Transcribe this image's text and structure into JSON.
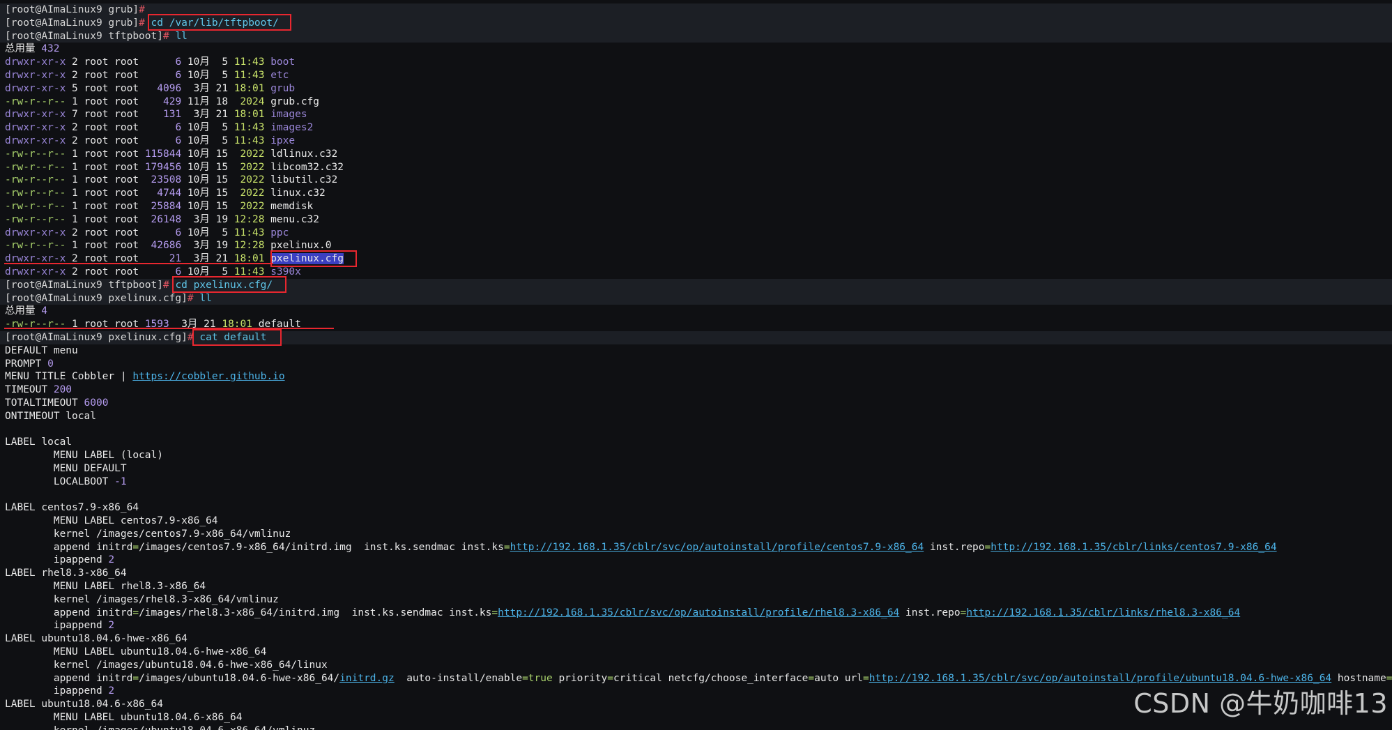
{
  "terminal": {
    "lines": [
      {
        "prompt_bg": true,
        "segs": [
          [
            "p",
            "[root@AImaLinux9 grub]"
          ],
          [
            "h",
            "#"
          ]
        ]
      },
      {
        "prompt_bg": true,
        "segs": [
          [
            "p",
            "[root@AImaLinux9 grub]"
          ],
          [
            "h",
            "# "
          ],
          [
            "c",
            "cd /var/lib/tftpboot/"
          ]
        ]
      },
      {
        "prompt_bg": true,
        "segs": [
          [
            "p",
            "[root@AImaLinux9 tftpboot]"
          ],
          [
            "h",
            "# "
          ],
          [
            "c",
            "ll"
          ]
        ]
      },
      {
        "segs": [
          [
            "w",
            "总用量 "
          ],
          [
            "n",
            "432"
          ]
        ]
      },
      {
        "segs": [
          [
            "pd",
            "drwxr-xr-x"
          ],
          [
            "w",
            " 2 root root      "
          ],
          [
            "n",
            "6"
          ],
          [
            "w",
            " 10月  5 "
          ],
          [
            "t",
            "11:43"
          ],
          [
            "w",
            " "
          ],
          [
            "d",
            "boot"
          ]
        ]
      },
      {
        "segs": [
          [
            "pd",
            "drwxr-xr-x"
          ],
          [
            "w",
            " 2 root root      "
          ],
          [
            "n",
            "6"
          ],
          [
            "w",
            " 10月  5 "
          ],
          [
            "t",
            "11:43"
          ],
          [
            "w",
            " "
          ],
          [
            "d",
            "etc"
          ]
        ]
      },
      {
        "segs": [
          [
            "pd",
            "drwxr-xr-x"
          ],
          [
            "w",
            " 5 root root   "
          ],
          [
            "n",
            "4096"
          ],
          [
            "w",
            "  3月 21 "
          ],
          [
            "t",
            "18:01"
          ],
          [
            "w",
            " "
          ],
          [
            "d",
            "grub"
          ]
        ]
      },
      {
        "segs": [
          [
            "pf",
            "-rw-r--r--"
          ],
          [
            "w",
            " 1 root root    "
          ],
          [
            "n",
            "429"
          ],
          [
            "w",
            " 11月 18  "
          ],
          [
            "y",
            "2024"
          ],
          [
            "w",
            " grub.cfg"
          ]
        ]
      },
      {
        "segs": [
          [
            "pd",
            "drwxr-xr-x"
          ],
          [
            "w",
            " 7 root root    "
          ],
          [
            "n",
            "131"
          ],
          [
            "w",
            "  3月 21 "
          ],
          [
            "t",
            "18:01"
          ],
          [
            "w",
            " "
          ],
          [
            "d",
            "images"
          ]
        ]
      },
      {
        "segs": [
          [
            "pd",
            "drwxr-xr-x"
          ],
          [
            "w",
            " 2 root root      "
          ],
          [
            "n",
            "6"
          ],
          [
            "w",
            " 10月  5 "
          ],
          [
            "t",
            "11:43"
          ],
          [
            "w",
            " "
          ],
          [
            "d",
            "images2"
          ]
        ]
      },
      {
        "segs": [
          [
            "pd",
            "drwxr-xr-x"
          ],
          [
            "w",
            " 2 root root      "
          ],
          [
            "n",
            "6"
          ],
          [
            "w",
            " 10月  5 "
          ],
          [
            "t",
            "11:43"
          ],
          [
            "w",
            " "
          ],
          [
            "d",
            "ipxe"
          ]
        ]
      },
      {
        "segs": [
          [
            "pf",
            "-rw-r--r--"
          ],
          [
            "w",
            " 1 root root "
          ],
          [
            "n",
            "115844"
          ],
          [
            "w",
            " 10月 15  "
          ],
          [
            "y",
            "2022"
          ],
          [
            "w",
            " ldlinux.c32"
          ]
        ]
      },
      {
        "segs": [
          [
            "pf",
            "-rw-r--r--"
          ],
          [
            "w",
            " 1 root root "
          ],
          [
            "n",
            "179456"
          ],
          [
            "w",
            " 10月 15  "
          ],
          [
            "y",
            "2022"
          ],
          [
            "w",
            " libcom32.c32"
          ]
        ]
      },
      {
        "segs": [
          [
            "pf",
            "-rw-r--r--"
          ],
          [
            "w",
            " 1 root root  "
          ],
          [
            "n",
            "23508"
          ],
          [
            "w",
            " 10月 15  "
          ],
          [
            "y",
            "2022"
          ],
          [
            "w",
            " libutil.c32"
          ]
        ]
      },
      {
        "segs": [
          [
            "pf",
            "-rw-r--r--"
          ],
          [
            "w",
            " 1 root root   "
          ],
          [
            "n",
            "4744"
          ],
          [
            "w",
            " 10月 15  "
          ],
          [
            "y",
            "2022"
          ],
          [
            "w",
            " linux.c32"
          ]
        ]
      },
      {
        "segs": [
          [
            "pf",
            "-rw-r--r--"
          ],
          [
            "w",
            " 1 root root  "
          ],
          [
            "n",
            "25884"
          ],
          [
            "w",
            " 10月 15  "
          ],
          [
            "y",
            "2022"
          ],
          [
            "w",
            " memdisk"
          ]
        ]
      },
      {
        "segs": [
          [
            "pf",
            "-rw-r--r--"
          ],
          [
            "w",
            " 1 root root  "
          ],
          [
            "n",
            "26148"
          ],
          [
            "w",
            "  3月 19 "
          ],
          [
            "t",
            "12:28"
          ],
          [
            "w",
            " menu.c32"
          ]
        ]
      },
      {
        "segs": [
          [
            "pd",
            "drwxr-xr-x"
          ],
          [
            "w",
            " 2 root root      "
          ],
          [
            "n",
            "6"
          ],
          [
            "w",
            " 10月  5 "
          ],
          [
            "t",
            "11:43"
          ],
          [
            "w",
            " "
          ],
          [
            "d",
            "ppc"
          ]
        ]
      },
      {
        "segs": [
          [
            "pf",
            "-rw-r--r--"
          ],
          [
            "w",
            " 1 root root  "
          ],
          [
            "n",
            "42686"
          ],
          [
            "w",
            "  3月 19 "
          ],
          [
            "t",
            "12:28"
          ],
          [
            "w",
            " pxelinux.0"
          ]
        ]
      },
      {
        "segs": [
          [
            "pd",
            "drwxr-xr-x"
          ],
          [
            "w",
            " 2 root root     "
          ],
          [
            "n",
            "21"
          ],
          [
            "w",
            "  3月 21 "
          ],
          [
            "t",
            "18:01"
          ],
          [
            "w",
            " "
          ],
          [
            "s",
            "pxelinux.cfg"
          ]
        ]
      },
      {
        "segs": [
          [
            "pd",
            "drwxr-xr-x"
          ],
          [
            "w",
            " 2 root root      "
          ],
          [
            "n",
            "6"
          ],
          [
            "w",
            " 10月  5 "
          ],
          [
            "t",
            "11:43"
          ],
          [
            "w",
            " "
          ],
          [
            "d",
            "s390x"
          ]
        ]
      },
      {
        "prompt_bg": true,
        "segs": [
          [
            "p",
            "[root@AImaLinux9 tftpboot]"
          ],
          [
            "h",
            "# "
          ],
          [
            "c",
            "cd pxelinux.cfg/"
          ]
        ]
      },
      {
        "prompt_bg": true,
        "segs": [
          [
            "p",
            "[root@AImaLinux9 pxelinux.cfg]"
          ],
          [
            "h",
            "# "
          ],
          [
            "c",
            "ll"
          ]
        ]
      },
      {
        "segs": [
          [
            "w",
            "总用量 "
          ],
          [
            "n",
            "4"
          ]
        ]
      },
      {
        "segs": [
          [
            "pf",
            "-rw-r--r--"
          ],
          [
            "w",
            " 1 root root "
          ],
          [
            "n",
            "1593"
          ],
          [
            "w",
            "  3月 21 "
          ],
          [
            "t",
            "18:01"
          ],
          [
            "w",
            " default"
          ]
        ]
      },
      {
        "prompt_bg": true,
        "segs": [
          [
            "p",
            "[root@AImaLinux9 pxelinux.cfg]"
          ],
          [
            "h",
            "# "
          ],
          [
            "c",
            "cat default"
          ]
        ]
      },
      {
        "segs": [
          [
            "w",
            "DEFAULT menu"
          ]
        ]
      },
      {
        "segs": [
          [
            "w",
            "PROMPT "
          ],
          [
            "n",
            "0"
          ]
        ]
      },
      {
        "segs": [
          [
            "w",
            "MENU TITLE Cobbler | "
          ],
          [
            "l",
            "https://cobbler.github.io"
          ]
        ]
      },
      {
        "segs": [
          [
            "w",
            "TIMEOUT "
          ],
          [
            "n",
            "200"
          ]
        ]
      },
      {
        "segs": [
          [
            "w",
            "TOTALTIMEOUT "
          ],
          [
            "n",
            "6000"
          ]
        ]
      },
      {
        "segs": [
          [
            "w",
            "ONTIMEOUT local"
          ]
        ]
      },
      {
        "segs": [
          [
            "w",
            ""
          ]
        ]
      },
      {
        "segs": [
          [
            "w",
            "LABEL local"
          ]
        ]
      },
      {
        "segs": [
          [
            "w",
            "        MENU LABEL (local)"
          ]
        ]
      },
      {
        "segs": [
          [
            "w",
            "        MENU DEFAULT"
          ]
        ]
      },
      {
        "segs": [
          [
            "w",
            "        LOCALBOOT "
          ],
          [
            "n",
            "-1"
          ]
        ]
      },
      {
        "segs": [
          [
            "w",
            ""
          ]
        ]
      },
      {
        "segs": [
          [
            "w",
            "LABEL centos7.9-x86_64"
          ]
        ]
      },
      {
        "segs": [
          [
            "w",
            "        MENU LABEL centos7.9-x86_64"
          ]
        ]
      },
      {
        "segs": [
          [
            "w",
            "        kernel /images/centos7.9-x86_64/vmlinuz"
          ]
        ]
      },
      {
        "segs": [
          [
            "w",
            "        append initrd"
          ],
          [
            "e",
            "="
          ],
          [
            "w",
            "/images/centos7.9-x86_64/initrd.img  inst.ks.sendmac inst.ks"
          ],
          [
            "e",
            "="
          ],
          [
            "l",
            "http://192.168.1.35/cblr/svc/op/autoinstall/profile/centos7.9-x86_64"
          ],
          [
            "w",
            " inst.repo"
          ],
          [
            "e",
            "="
          ],
          [
            "l",
            "http://192.168.1.35/cblr/links/centos7.9-x86_64"
          ]
        ]
      },
      {
        "segs": [
          [
            "w",
            "        ipappend "
          ],
          [
            "n",
            "2"
          ]
        ]
      },
      {
        "segs": [
          [
            "w",
            "LABEL rhel8.3-x86_64"
          ]
        ]
      },
      {
        "segs": [
          [
            "w",
            "        MENU LABEL rhel8.3-x86_64"
          ]
        ]
      },
      {
        "segs": [
          [
            "w",
            "        kernel /images/rhel8.3-x86_64/vmlinuz"
          ]
        ]
      },
      {
        "segs": [
          [
            "w",
            "        append initrd"
          ],
          [
            "e",
            "="
          ],
          [
            "w",
            "/images/rhel8.3-x86_64/initrd.img  inst.ks.sendmac inst.ks"
          ],
          [
            "e",
            "="
          ],
          [
            "l",
            "http://192.168.1.35/cblr/svc/op/autoinstall/profile/rhel8.3-x86_64"
          ],
          [
            "w",
            " inst.repo"
          ],
          [
            "e",
            "="
          ],
          [
            "l",
            "http://192.168.1.35/cblr/links/rhel8.3-x86_64"
          ]
        ]
      },
      {
        "segs": [
          [
            "w",
            "        ipappend "
          ],
          [
            "n",
            "2"
          ]
        ]
      },
      {
        "segs": [
          [
            "w",
            "LABEL ubuntu18.04.6-hwe-x86_64"
          ]
        ]
      },
      {
        "segs": [
          [
            "w",
            "        MENU LABEL ubuntu18.04.6-hwe-x86_64"
          ]
        ]
      },
      {
        "segs": [
          [
            "w",
            "        kernel /images/ubuntu18.04.6-hwe-x86_64/linux"
          ]
        ]
      },
      {
        "segs": [
          [
            "w",
            "        append initrd"
          ],
          [
            "e",
            "="
          ],
          [
            "w",
            "/images/ubuntu18.04.6-hwe-x86_64/"
          ],
          [
            "l",
            "initrd.gz"
          ],
          [
            "w",
            "  auto-install/enable"
          ],
          [
            "e",
            "="
          ],
          [
            "tr",
            "true"
          ],
          [
            "w",
            " priority"
          ],
          [
            "e",
            "="
          ],
          [
            "w",
            "critical netcfg/choose_interface"
          ],
          [
            "e",
            "="
          ],
          [
            "w",
            "auto url"
          ],
          [
            "e",
            "="
          ],
          [
            "l",
            "http://192.168.1.35/cblr/svc/op/autoinstall/profile/ubuntu18.04.6-hwe-x86_64"
          ],
          [
            "w",
            " hostname"
          ],
          [
            "e",
            "="
          ]
        ]
      },
      {
        "segs": [
          [
            "w",
            "        ipappend "
          ],
          [
            "n",
            "2"
          ]
        ]
      },
      {
        "segs": [
          [
            "w",
            "LABEL ubuntu18.04.6-x86_64"
          ]
        ]
      },
      {
        "segs": [
          [
            "w",
            "        MENU LABEL ubuntu18.04.6-x86_64"
          ]
        ]
      },
      {
        "segs": [
          [
            "w",
            "        kernel /images/ubuntu18.04.6-x86_64/vmlinuz"
          ]
        ]
      }
    ]
  },
  "watermark": "CSDN @牛奶咖啡13",
  "colors": {
    "background": "#0f1013",
    "prompt_hash": "#e05561",
    "command": "#5fc5e8",
    "directory": "#9a86d8",
    "file_perm": "#a9d26c",
    "number": "#b59cf0",
    "time": "#c8e26a",
    "link": "#4cb3e8",
    "highlight_box": "#e8272f",
    "selection": "#3b3fc1"
  }
}
